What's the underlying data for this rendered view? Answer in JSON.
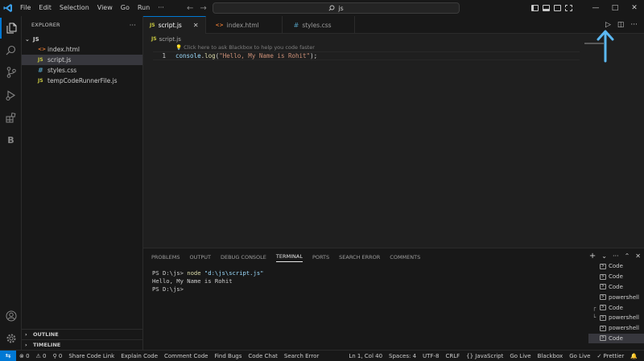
{
  "title_bar": {
    "menu": [
      "File",
      "Edit",
      "Selection",
      "View",
      "Go",
      "Run",
      "···"
    ],
    "search": "js"
  },
  "sidebar": {
    "header": "EXPLORER",
    "more": "···",
    "folder": "JS",
    "files": [
      {
        "icon": "<>",
        "name": "index.html"
      },
      {
        "icon": "JS",
        "name": "script.js"
      },
      {
        "icon": "#",
        "name": "styles.css"
      },
      {
        "icon": "JS",
        "name": "tempCodeRunnerFile.js"
      }
    ],
    "outline": "OUTLINE",
    "timeline": "TIMELINE",
    "chevron_collapsed": "›",
    "chevron_open": "⌄"
  },
  "tabs": [
    {
      "icon": "JS",
      "label": "script.js",
      "close": "✕"
    },
    {
      "icon": "<>",
      "label": "index.html"
    },
    {
      "icon": "#",
      "label": "styles.css"
    }
  ],
  "editor": {
    "breadcrumb_icon": "JS",
    "breadcrumb": "script.js",
    "hint": "💡 Click here to ask Blackbox to help you code faster",
    "line_number": "1",
    "code": {
      "obj": "console",
      "dot": ".",
      "fn": "log",
      "open": "(",
      "str": "\"Hello, My Name is Rohit\"",
      "close": ");"
    }
  },
  "panel": {
    "tabs": [
      "PROBLEMS",
      "OUTPUT",
      "DEBUG CONSOLE",
      "TERMINAL",
      "PORTS",
      "SEARCH ERROR",
      "COMMENTS"
    ],
    "actions": {
      "add": "+",
      "dropdown": "⌄",
      "more": "···",
      "maximize": "⌃",
      "close": "✕"
    },
    "terminal": {
      "prompt1": "PS D:\\js> ",
      "cmd": "node",
      "arg": "\"d:\\js\\script.js\"",
      "output": "Hello, My Name is Rohit",
      "prompt2": "PS D:\\js>"
    },
    "terminal_list": [
      {
        "label": "Code",
        "tree": ""
      },
      {
        "label": "Code",
        "tree": ""
      },
      {
        "label": "Code",
        "tree": ""
      },
      {
        "label": "powershell",
        "tree": ""
      },
      {
        "label": "Code",
        "tree": "┌"
      },
      {
        "label": "powershell",
        "tree": "└"
      },
      {
        "label": "powershell",
        "tree": ""
      },
      {
        "label": "Code",
        "tree": ""
      }
    ]
  },
  "status_bar": {
    "remote": "⇆",
    "errors": "⊗ 0",
    "warnings": "⚠ 0",
    "ports": "⚲ 0",
    "left_items": [
      "Share Code Link",
      "Explain Code",
      "Comment Code",
      "Find Bugs",
      "Code Chat",
      "Search Error"
    ],
    "right_items": [
      "Ln 1, Col 40",
      "Spaces: 4",
      "UTF-8",
      "CRLF",
      "{} JavaScript",
      "Go Live",
      "Blackbox",
      "Go Live",
      "✓ Prettier",
      "🔔"
    ]
  },
  "colors": {
    "accent": "#0078d4",
    "annotation_arrow": "#5bb8f2"
  }
}
